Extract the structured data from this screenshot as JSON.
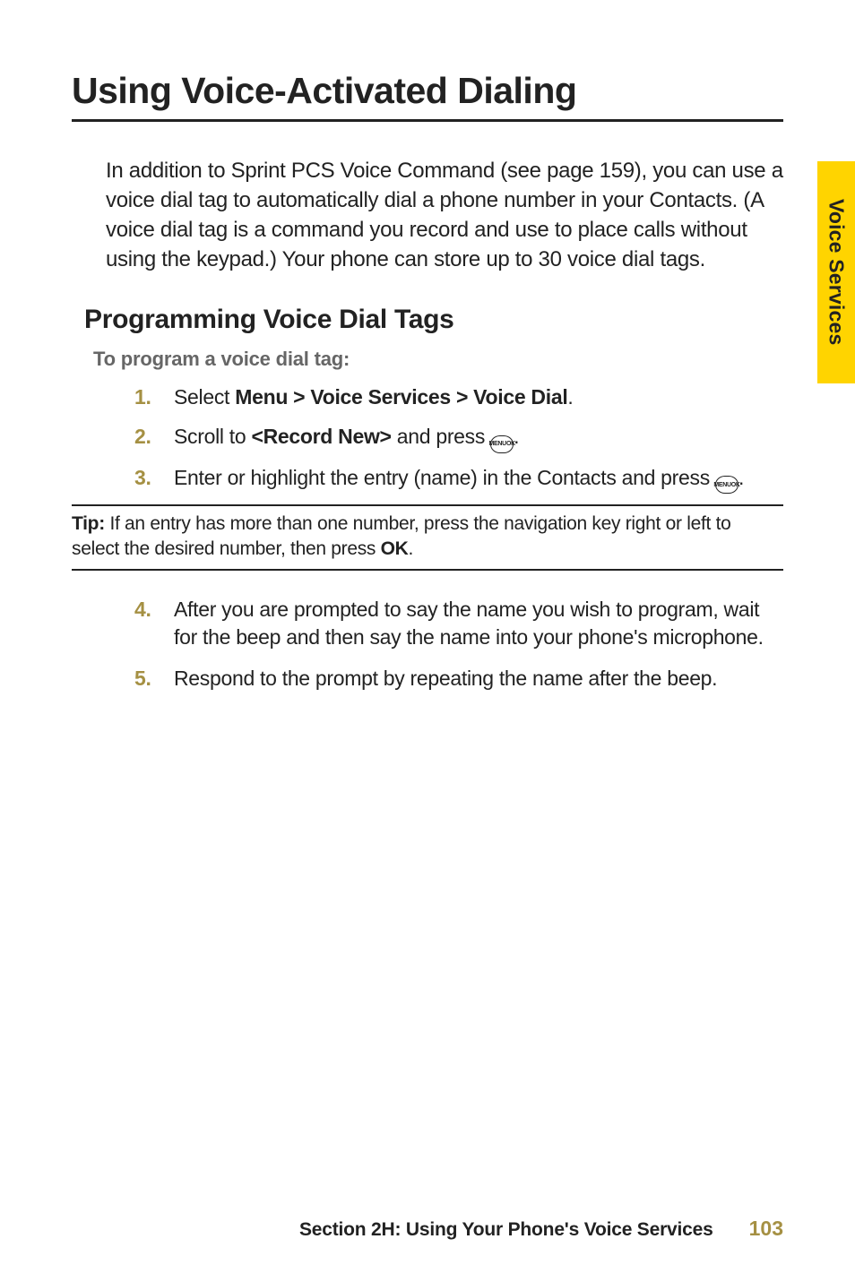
{
  "side_tab": "Voice Services",
  "h1": "Using Voice-Activated Dialing",
  "intro": "In addition to Sprint PCS Voice Command (see page 159), you can use a voice dial tag to automatically dial a phone number in your Contacts. (A voice dial tag is a command you record and use to place calls without using the keypad.) Your phone can store up to 30 voice dial tags.",
  "h2": "Programming Voice Dial Tags",
  "subhead": "To program a voice dial tag:",
  "steps_a": {
    "1": {
      "pre": "Select ",
      "bold": "Menu > Voice Services > Voice Dial",
      "post": "."
    },
    "2": {
      "pre": "Scroll to ",
      "bold": "<Record New>",
      "mid": " and press ",
      "post": "."
    },
    "3": {
      "pre": "Enter or highlight the entry (name) in the Contacts and press ",
      "post": "."
    }
  },
  "icon": {
    "top": "MENU",
    "bot": "OK"
  },
  "tip": {
    "label": "Tip: ",
    "text_a": "If an entry has more than one number, press the navigation key right or left to select the desired number, then press ",
    "bold": "OK",
    "text_b": "."
  },
  "steps_b": {
    "4": "After you are prompted to say the name you wish to program, wait for the beep and then say the name into your phone's microphone.",
    "5": "Respond to the prompt by repeating the name after the beep."
  },
  "footer": {
    "section": "Section 2H: Using Your Phone's Voice Services",
    "page": "103"
  }
}
